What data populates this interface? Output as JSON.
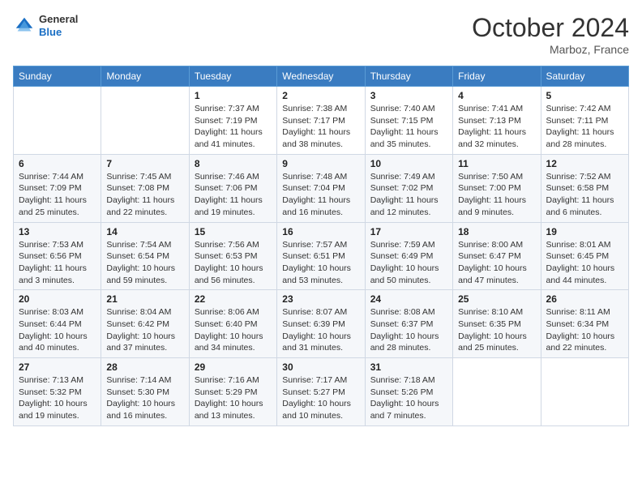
{
  "header": {
    "logo": {
      "general": "General",
      "blue": "Blue"
    },
    "month": "October 2024",
    "location": "Marboz, France"
  },
  "weekdays": [
    "Sunday",
    "Monday",
    "Tuesday",
    "Wednesday",
    "Thursday",
    "Friday",
    "Saturday"
  ],
  "weeks": [
    [
      {
        "day": "",
        "info": ""
      },
      {
        "day": "",
        "info": ""
      },
      {
        "day": "1",
        "info": "Sunrise: 7:37 AM\nSunset: 7:19 PM\nDaylight: 11 hours and 41 minutes."
      },
      {
        "day": "2",
        "info": "Sunrise: 7:38 AM\nSunset: 7:17 PM\nDaylight: 11 hours and 38 minutes."
      },
      {
        "day": "3",
        "info": "Sunrise: 7:40 AM\nSunset: 7:15 PM\nDaylight: 11 hours and 35 minutes."
      },
      {
        "day": "4",
        "info": "Sunrise: 7:41 AM\nSunset: 7:13 PM\nDaylight: 11 hours and 32 minutes."
      },
      {
        "day": "5",
        "info": "Sunrise: 7:42 AM\nSunset: 7:11 PM\nDaylight: 11 hours and 28 minutes."
      }
    ],
    [
      {
        "day": "6",
        "info": "Sunrise: 7:44 AM\nSunset: 7:09 PM\nDaylight: 11 hours and 25 minutes."
      },
      {
        "day": "7",
        "info": "Sunrise: 7:45 AM\nSunset: 7:08 PM\nDaylight: 11 hours and 22 minutes."
      },
      {
        "day": "8",
        "info": "Sunrise: 7:46 AM\nSunset: 7:06 PM\nDaylight: 11 hours and 19 minutes."
      },
      {
        "day": "9",
        "info": "Sunrise: 7:48 AM\nSunset: 7:04 PM\nDaylight: 11 hours and 16 minutes."
      },
      {
        "day": "10",
        "info": "Sunrise: 7:49 AM\nSunset: 7:02 PM\nDaylight: 11 hours and 12 minutes."
      },
      {
        "day": "11",
        "info": "Sunrise: 7:50 AM\nSunset: 7:00 PM\nDaylight: 11 hours and 9 minutes."
      },
      {
        "day": "12",
        "info": "Sunrise: 7:52 AM\nSunset: 6:58 PM\nDaylight: 11 hours and 6 minutes."
      }
    ],
    [
      {
        "day": "13",
        "info": "Sunrise: 7:53 AM\nSunset: 6:56 PM\nDaylight: 11 hours and 3 minutes."
      },
      {
        "day": "14",
        "info": "Sunrise: 7:54 AM\nSunset: 6:54 PM\nDaylight: 10 hours and 59 minutes."
      },
      {
        "day": "15",
        "info": "Sunrise: 7:56 AM\nSunset: 6:53 PM\nDaylight: 10 hours and 56 minutes."
      },
      {
        "day": "16",
        "info": "Sunrise: 7:57 AM\nSunset: 6:51 PM\nDaylight: 10 hours and 53 minutes."
      },
      {
        "day": "17",
        "info": "Sunrise: 7:59 AM\nSunset: 6:49 PM\nDaylight: 10 hours and 50 minutes."
      },
      {
        "day": "18",
        "info": "Sunrise: 8:00 AM\nSunset: 6:47 PM\nDaylight: 10 hours and 47 minutes."
      },
      {
        "day": "19",
        "info": "Sunrise: 8:01 AM\nSunset: 6:45 PM\nDaylight: 10 hours and 44 minutes."
      }
    ],
    [
      {
        "day": "20",
        "info": "Sunrise: 8:03 AM\nSunset: 6:44 PM\nDaylight: 10 hours and 40 minutes."
      },
      {
        "day": "21",
        "info": "Sunrise: 8:04 AM\nSunset: 6:42 PM\nDaylight: 10 hours and 37 minutes."
      },
      {
        "day": "22",
        "info": "Sunrise: 8:06 AM\nSunset: 6:40 PM\nDaylight: 10 hours and 34 minutes."
      },
      {
        "day": "23",
        "info": "Sunrise: 8:07 AM\nSunset: 6:39 PM\nDaylight: 10 hours and 31 minutes."
      },
      {
        "day": "24",
        "info": "Sunrise: 8:08 AM\nSunset: 6:37 PM\nDaylight: 10 hours and 28 minutes."
      },
      {
        "day": "25",
        "info": "Sunrise: 8:10 AM\nSunset: 6:35 PM\nDaylight: 10 hours and 25 minutes."
      },
      {
        "day": "26",
        "info": "Sunrise: 8:11 AM\nSunset: 6:34 PM\nDaylight: 10 hours and 22 minutes."
      }
    ],
    [
      {
        "day": "27",
        "info": "Sunrise: 7:13 AM\nSunset: 5:32 PM\nDaylight: 10 hours and 19 minutes."
      },
      {
        "day": "28",
        "info": "Sunrise: 7:14 AM\nSunset: 5:30 PM\nDaylight: 10 hours and 16 minutes."
      },
      {
        "day": "29",
        "info": "Sunrise: 7:16 AM\nSunset: 5:29 PM\nDaylight: 10 hours and 13 minutes."
      },
      {
        "day": "30",
        "info": "Sunrise: 7:17 AM\nSunset: 5:27 PM\nDaylight: 10 hours and 10 minutes."
      },
      {
        "day": "31",
        "info": "Sunrise: 7:18 AM\nSunset: 5:26 PM\nDaylight: 10 hours and 7 minutes."
      },
      {
        "day": "",
        "info": ""
      },
      {
        "day": "",
        "info": ""
      }
    ]
  ]
}
